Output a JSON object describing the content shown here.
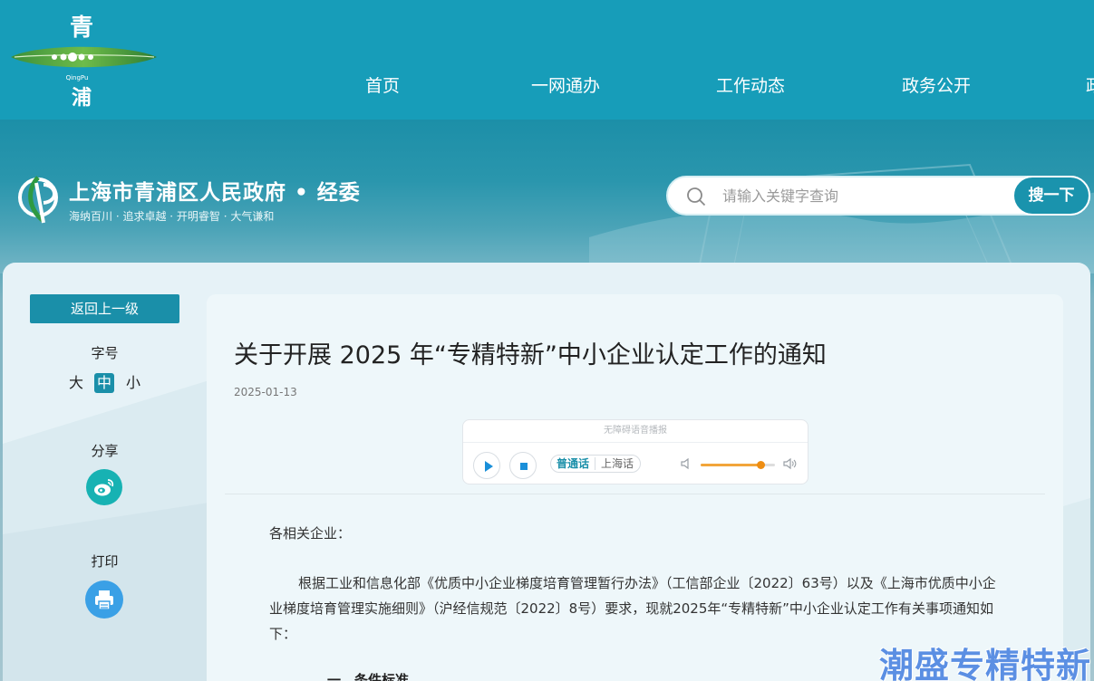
{
  "top_logo": {
    "char_top": "青",
    "pinyin": "QingPu",
    "char_bottom": "浦"
  },
  "nav": {
    "items": [
      "首页",
      "一网通办",
      "工作动态",
      "政务公开",
      "政"
    ]
  },
  "header": {
    "title": "上海市青浦区人民政府 • 经委",
    "slogan": "海纳百川 · 追求卓越 · 开明睿智 · 大气谦和"
  },
  "search": {
    "placeholder": "请输入关键字查询",
    "button_label": "搜一下"
  },
  "sidebar": {
    "back_label": "返回上一级",
    "font_label": "字号",
    "font_large": "大",
    "font_medium": "中",
    "font_small": "小",
    "share_label": "分享",
    "print_label": "打印"
  },
  "article": {
    "title": "关于开展 2025 年“专精特新”中小企业认定工作的通知",
    "date": "2025-01-13",
    "greeting": "各相关企业：",
    "paragraph": "根据工业和信息化部《优质中小企业梯度培育管理暂行办法》（工信部企业〔2022〕63号）以及《上海市优质中小企业梯度培育管理实施细则》（沪经信规范〔2022〕8号）要求，现就2025年“专精特新”中小企业认定工作有关事项通知如下：",
    "subhead": "一、条件标准"
  },
  "player": {
    "header": "无障碍语音播报",
    "lang_active": "普通话",
    "lang_other": "上海话",
    "volume": 0.8
  },
  "watermark": "潮盛专精特新",
  "colors": {
    "primary": "#1a8fa9",
    "nav_bg": "#179db9",
    "volume": "#ee8d12"
  }
}
